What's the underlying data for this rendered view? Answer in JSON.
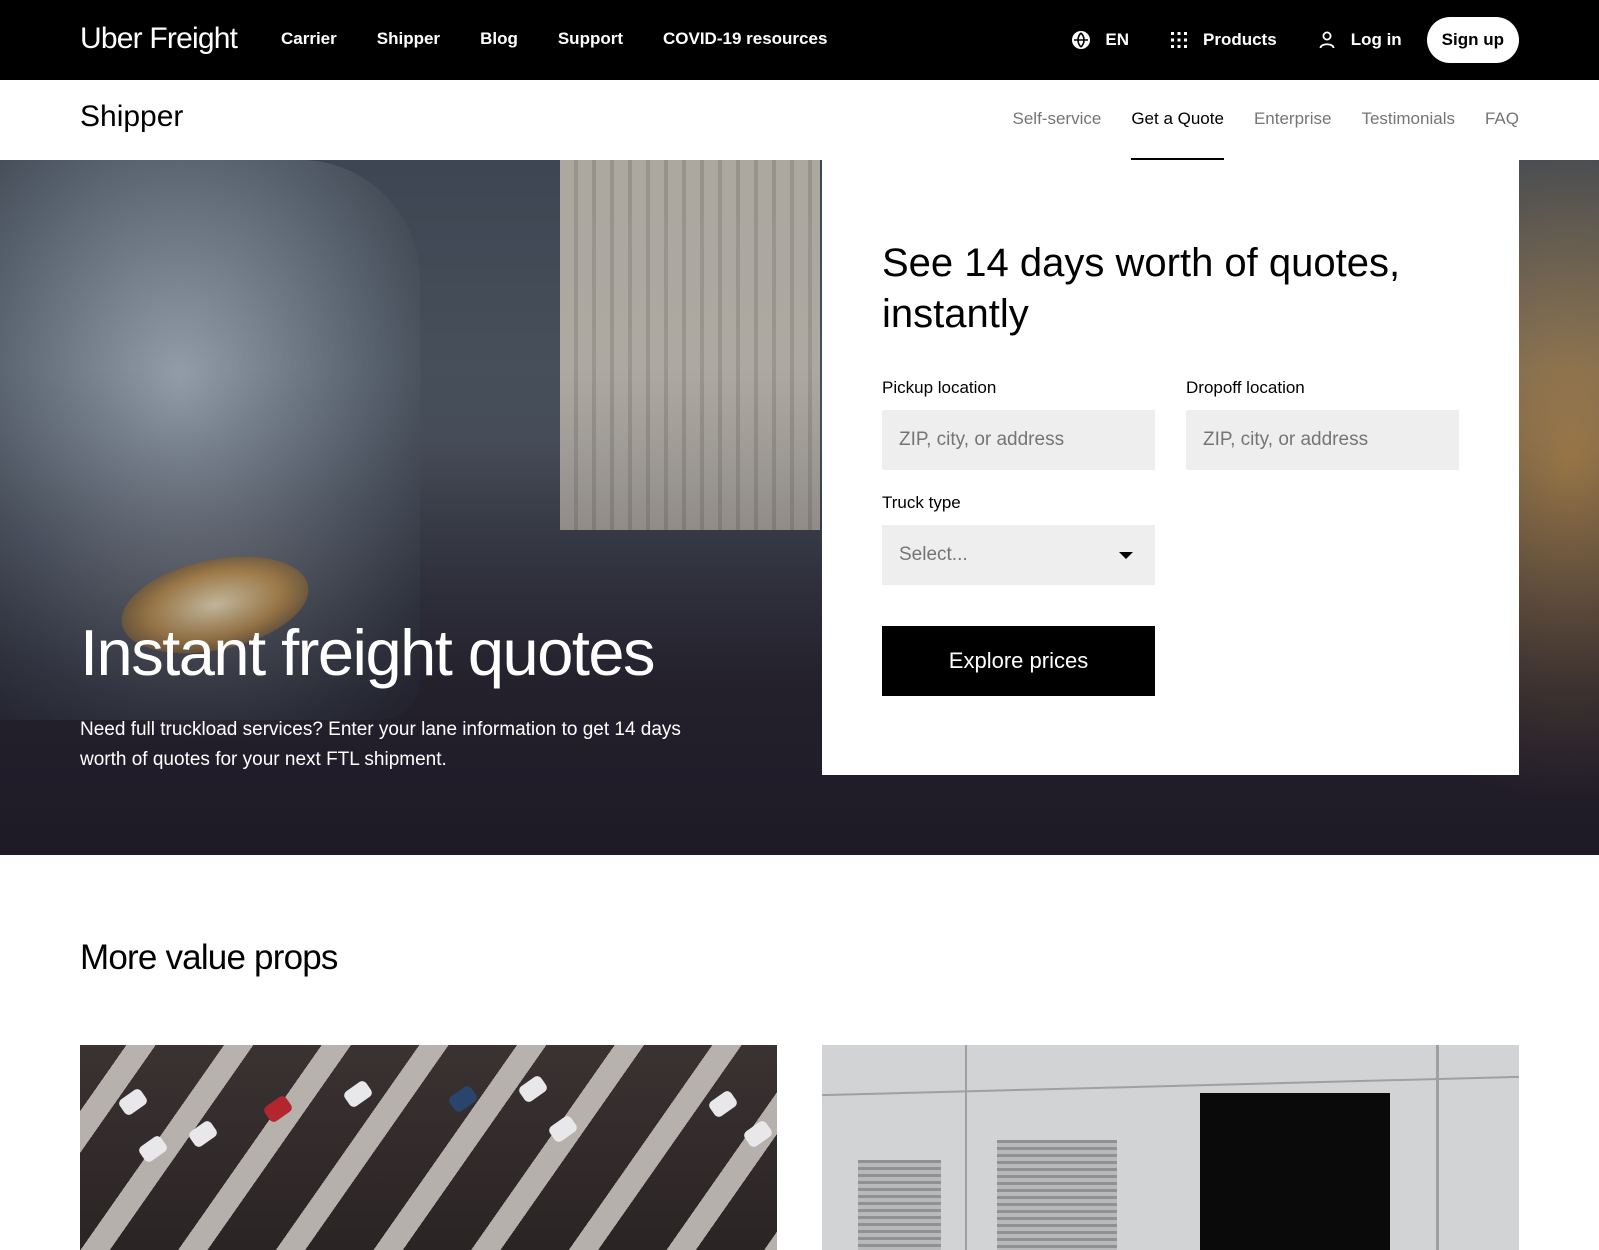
{
  "topnav": {
    "logo": "Uber Freight",
    "links": [
      "Carrier",
      "Shipper",
      "Blog",
      "Support",
      "COVID-19 resources"
    ],
    "language": "EN",
    "products": "Products",
    "login": "Log in",
    "signup": "Sign up"
  },
  "subnav": {
    "title": "Shipper",
    "links": [
      "Self-service",
      "Get a Quote",
      "Enterprise",
      "Testimonials",
      "FAQ"
    ],
    "active": "Get a Quote"
  },
  "hero": {
    "title": "Instant freight quotes",
    "subtitle": "Need full truckload services? Enter your lane information to get 14 days worth of quotes for your next FTL shipment."
  },
  "quote_form": {
    "heading": "See 14 days worth of quotes, instantly",
    "pickup_label": "Pickup location",
    "pickup_placeholder": "ZIP, city, or address",
    "dropoff_label": "Dropoff location",
    "dropoff_placeholder": "ZIP, city, or address",
    "truck_label": "Truck type",
    "truck_value": "Select...",
    "submit": "Explore prices"
  },
  "section": {
    "title": "More value props"
  }
}
